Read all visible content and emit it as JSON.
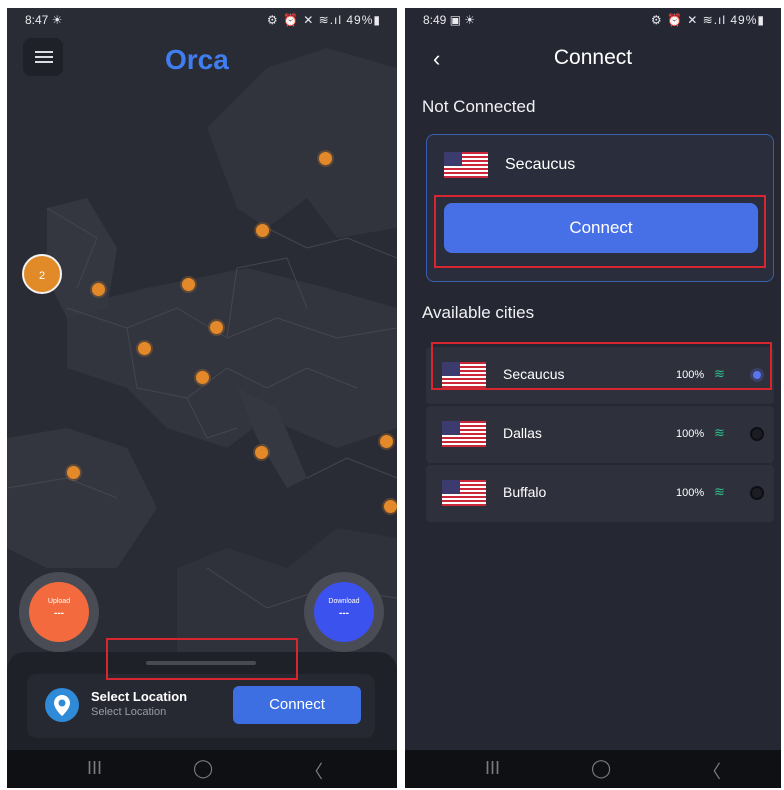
{
  "left_phone": {
    "status": {
      "time": "8:47 ☀",
      "icons": "⚙ ⏰ ✕ ≋.ıl 49%▮"
    },
    "brand": "Orca",
    "cluster_count": "2",
    "upload": {
      "label": "Upload",
      "value": "---",
      "color": "#f26a3d"
    },
    "download": {
      "label": "Download",
      "value": "---",
      "color": "#3c52ef"
    },
    "location": {
      "title": "Select Location",
      "subtitle": "Select Location"
    },
    "connect_label": "Connect"
  },
  "right_phone": {
    "status": {
      "time": "8:49 ▣ ☀",
      "icons": "⚙ ⏰ ✕ ≋.ıl 49%▮"
    },
    "title": "Connect",
    "back_glyph": "‹",
    "section_status": "Not Connected",
    "current_city": "Secaucus",
    "connect_label": "Connect",
    "section_cities": "Available cities",
    "cities": [
      {
        "name": "Secaucus",
        "signal": "100%",
        "selected": true
      },
      {
        "name": "Dallas",
        "signal": "100%",
        "selected": false
      },
      {
        "name": "Buffalo",
        "signal": "100%",
        "selected": false
      }
    ]
  },
  "nav": {
    "recent": "III",
    "home": "◯",
    "back": "〈"
  },
  "colors": {
    "accent": "#4870e6",
    "marker": "#e3892a",
    "highlight": "#d7262f",
    "signal": "#2fbf8a"
  }
}
